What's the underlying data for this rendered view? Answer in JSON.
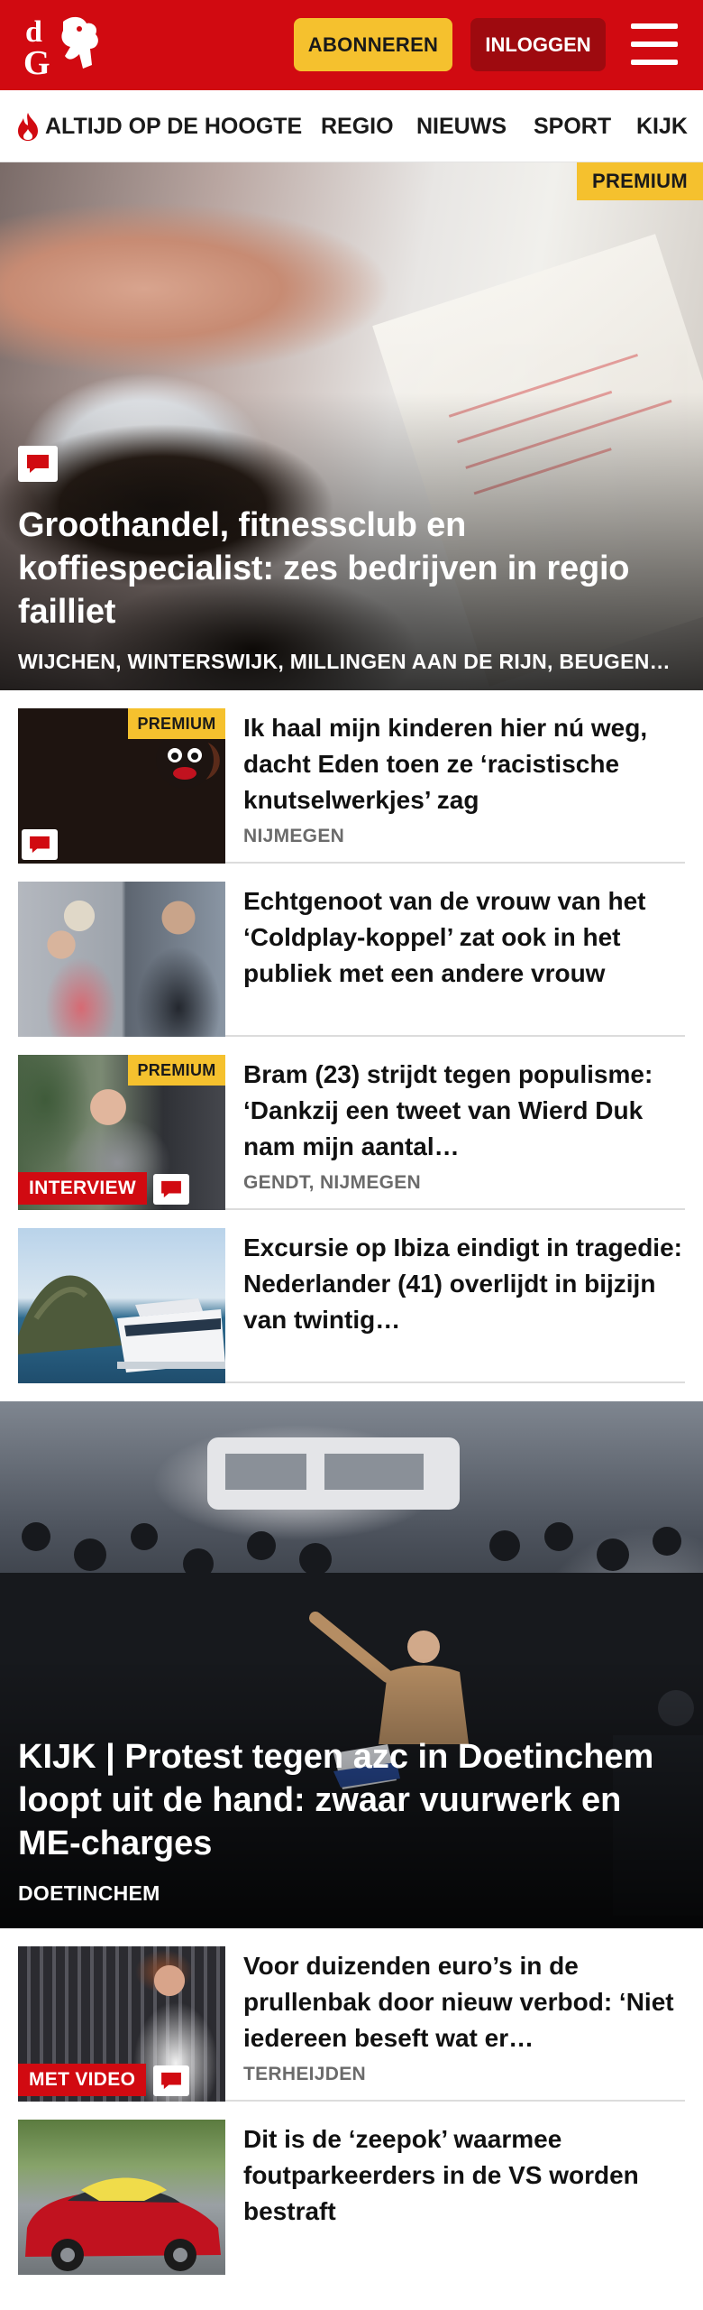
{
  "header": {
    "logo_text": "dG",
    "subscribe_label": "ABONNEREN",
    "login_label": "INLOGGEN",
    "brand_color": "#d10a11",
    "accent_color": "#f5c12e"
  },
  "nav": {
    "items": [
      {
        "label": "ALTIJD OP DE HOOGTE",
        "icon": "flame-icon"
      },
      {
        "label": "REGIO"
      },
      {
        "label": "NIEUWS"
      },
      {
        "label": "SPORT"
      },
      {
        "label": "KIJK"
      }
    ]
  },
  "hero": {
    "badge": "PREMIUM",
    "title": "Groothandel, fitnessclub en koffiespecialist: zes bedrijven in regio failliet",
    "location": "WIJCHEN, WINTERSWIJK, MILLINGEN AAN DE RIJN, BEUGEN…",
    "has_comments": true
  },
  "articles": [
    {
      "title": "Ik haal mijn kinderen hier nú weg, dacht Eden toen ze ‘racistische knutselwerkjes’ zag",
      "location": "NIJMEGEN",
      "badge": "PREMIUM",
      "has_comments": true
    },
    {
      "title": "Echtgenoot van de vrouw van het ‘Coldplay-koppel’ zat ook in het publiek met een andere vrouw"
    },
    {
      "title": "Bram (23) strijdt tegen populisme: ‘Dankzij een tweet van Wierd Duk nam mijn aantal…",
      "location": "GENDT, NIJMEGEN",
      "badge": "PREMIUM",
      "label": "INTERVIEW",
      "has_comments": true
    },
    {
      "title": "Excursie op Ibiza eindigt in tragedie: Nederlander (41) overlijdt in bijzijn van twintig…"
    }
  ],
  "big_story": {
    "title": "KIJK | Protest tegen azc in Doetinchem loopt uit de hand: zwaar vuurwerk en ME-charges",
    "location": "DOETINCHEM"
  },
  "articles_2": [
    {
      "title": "Voor duizenden euro’s in de prullenbak door nieuw verbod: ‘Niet iedereen beseft wat er…",
      "location": "TERHEIJDEN",
      "label": "MET VIDEO",
      "has_comments": true
    },
    {
      "title": "Dit is de ‘zeepok’ waarmee foutparkeerders in de VS worden bestraft"
    }
  ]
}
